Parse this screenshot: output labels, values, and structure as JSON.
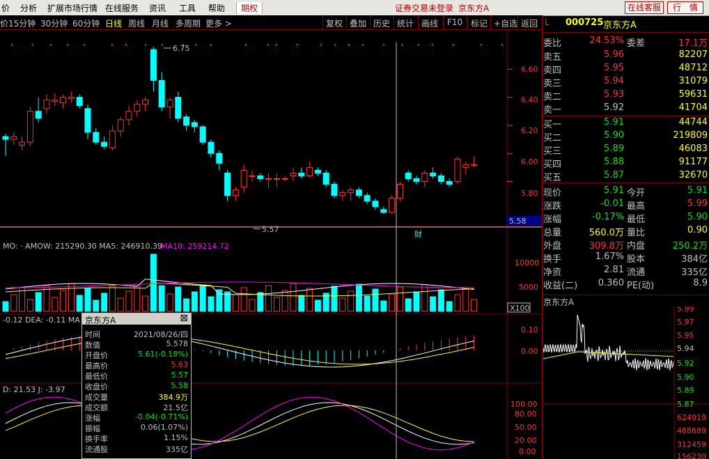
{
  "menubar": {
    "items": [
      "价",
      "分析",
      "扩展市场行情",
      "在线服务",
      "资讯",
      "工具",
      "帮助"
    ],
    "period_tab": "期权",
    "status": "证券交易未登录",
    "stock_name": "京东方A",
    "online_service": "在线客服",
    "quote": "行　情"
  },
  "toolbar": {
    "periods": [
      "价",
      "15分钟",
      "30分钟",
      "60分钟",
      "日线",
      "周线",
      "月线",
      "多周期",
      "更多 >"
    ],
    "selected_period": "日线",
    "tools": [
      "复权",
      "叠加",
      "历史",
      "统计",
      "画线",
      "F10",
      "标记",
      "+自选",
      "返回"
    ]
  },
  "chart": {
    "price_axis": [
      "6.60",
      "6.40",
      "6.20",
      "6.00",
      "5.80"
    ],
    "current_price_tag": "5.58",
    "high_label": "6.75",
    "low_label": "5.57",
    "fin_marker": "财",
    "volume": {
      "legend": "MO: ·  AMOW: 215290.30  MA5: 246910.39",
      "legend_ma10": "MA10: 259214.72",
      "axis": [
        "10000",
        "5000"
      ],
      "unit": "X100"
    },
    "macd": {
      "legend": "-0.12  DEA: -0.11  MA",
      "axis": [
        "0.10",
        "0.00"
      ]
    },
    "kdj": {
      "legend": "D: 21.53  J: -3.97",
      "axis": [
        "100.00",
        "80.00",
        "50.00",
        "20.00",
        "0.00"
      ]
    }
  },
  "chart_data": {
    "type": "candlestick",
    "title": "京东方A 日线",
    "ylim": [
      5.5,
      6.8
    ],
    "candles_ohlc": [
      [
        6.12,
        6.14,
        5.98,
        6.1
      ],
      [
        6.1,
        6.15,
        6.06,
        6.12
      ],
      [
        6.06,
        6.12,
        6.02,
        6.08
      ],
      [
        6.08,
        6.33,
        6.05,
        6.3
      ],
      [
        6.3,
        6.4,
        6.22,
        6.25
      ],
      [
        6.32,
        6.42,
        6.28,
        6.38
      ],
      [
        6.37,
        6.43,
        6.34,
        6.38
      ],
      [
        6.36,
        6.42,
        6.32,
        6.4
      ],
      [
        6.39,
        6.44,
        6.36,
        6.4
      ],
      [
        6.4,
        6.42,
        6.32,
        6.34
      ],
      [
        6.32,
        6.35,
        6.1,
        6.15
      ],
      [
        6.15,
        6.18,
        6.06,
        6.08
      ],
      [
        6.08,
        6.12,
        6.03,
        6.05
      ],
      [
        6.04,
        6.2,
        6.02,
        6.16
      ],
      [
        6.16,
        6.26,
        6.12,
        6.24
      ],
      [
        6.24,
        6.34,
        6.2,
        6.3
      ],
      [
        6.3,
        6.38,
        6.26,
        6.35
      ],
      [
        6.35,
        6.4,
        6.3,
        6.38
      ],
      [
        6.74,
        6.76,
        6.44,
        6.52
      ],
      [
        6.52,
        6.58,
        6.3,
        6.33
      ],
      [
        6.33,
        6.4,
        6.25,
        6.38
      ],
      [
        6.4,
        6.44,
        6.22,
        6.25
      ],
      [
        6.26,
        6.28,
        6.16,
        6.2
      ],
      [
        6.22,
        6.24,
        6.15,
        6.19
      ],
      [
        6.19,
        6.2,
        6.06,
        6.08
      ],
      [
        6.08,
        6.1,
        5.97,
        6.0
      ],
      [
        6.0,
        6.02,
        5.88,
        5.93
      ],
      [
        5.86,
        5.88,
        5.66,
        5.7
      ],
      [
        5.7,
        5.76,
        5.66,
        5.74
      ],
      [
        5.76,
        5.92,
        5.72,
        5.88
      ],
      [
        5.84,
        5.88,
        5.8,
        5.84
      ],
      [
        5.84,
        5.86,
        5.8,
        5.82
      ],
      [
        5.82,
        5.86,
        5.75,
        5.82
      ],
      [
        5.82,
        5.86,
        5.76,
        5.82
      ],
      [
        5.82,
        5.84,
        5.8,
        5.82
      ],
      [
        5.84,
        5.9,
        5.8,
        5.86
      ],
      [
        5.86,
        5.9,
        5.82,
        5.84
      ],
      [
        5.84,
        5.94,
        5.83,
        5.9
      ],
      [
        5.88,
        5.9,
        5.84,
        5.86
      ],
      [
        5.86,
        5.88,
        5.76,
        5.78
      ],
      [
        5.78,
        5.8,
        5.68,
        5.7
      ],
      [
        5.7,
        5.74,
        5.66,
        5.72
      ],
      [
        5.72,
        5.76,
        5.66,
        5.74
      ],
      [
        5.74,
        5.76,
        5.68,
        5.7
      ],
      [
        5.7,
        5.72,
        5.64,
        5.66
      ],
      [
        5.66,
        5.68,
        5.6,
        5.62
      ],
      [
        5.6,
        5.62,
        5.57,
        5.58
      ],
      [
        5.58,
        5.7,
        5.57,
        5.68
      ],
      [
        5.68,
        5.8,
        5.66,
        5.78
      ],
      [
        5.86,
        5.88,
        5.8,
        5.82
      ],
      [
        5.82,
        5.84,
        5.78,
        5.8
      ],
      [
        5.8,
        5.88,
        5.76,
        5.86
      ],
      [
        5.86,
        5.9,
        5.82,
        5.84
      ],
      [
        5.84,
        5.86,
        5.78,
        5.8
      ],
      [
        5.8,
        5.82,
        5.76,
        5.78
      ],
      [
        5.8,
        5.98,
        5.78,
        5.96
      ],
      [
        5.9,
        5.94,
        5.85,
        5.92
      ],
      [
        5.92,
        5.98,
        5.9,
        5.92
      ]
    ]
  },
  "right_panel": {
    "code_label": "L",
    "code": "000725",
    "name": "京东方A",
    "weibi": {
      "label": "委比",
      "value": "24.53%",
      "wc_label": "委差",
      "wc_value": "17.1万"
    },
    "asks": [
      {
        "label": "卖五",
        "price": "5.96",
        "vol": "82207"
      },
      {
        "label": "卖四",
        "price": "5.95",
        "vol": "48712"
      },
      {
        "label": "卖三",
        "price": "5.94",
        "vol": "31079"
      },
      {
        "label": "卖二",
        "price": "5.93",
        "vol": "59631"
      },
      {
        "label": "卖一",
        "price": "5.92",
        "vol": "41704"
      }
    ],
    "bids": [
      {
        "label": "买一",
        "price": "5.91",
        "vol": "44744"
      },
      {
        "label": "买二",
        "price": "5.90",
        "vol": "219809"
      },
      {
        "label": "买三",
        "price": "5.89",
        "vol": "46083"
      },
      {
        "label": "买四",
        "price": "5.88",
        "vol": "91177"
      },
      {
        "label": "买五",
        "price": "5.87",
        "vol": "32670"
      }
    ],
    "stats": [
      {
        "k1": "现价",
        "v1": "5.91",
        "c1": "gr",
        "k2": "今开",
        "v2": "5.91",
        "c2": "gr"
      },
      {
        "k1": "涨跌",
        "v1": "-0.01",
        "c1": "gr",
        "k2": "最高",
        "v2": "5.99",
        "c2": "rd"
      },
      {
        "k1": "涨幅",
        "v1": "-0.17%",
        "c1": "gr",
        "k2": "最低",
        "v2": "5.90",
        "c2": "gr"
      },
      {
        "k1": "总量",
        "v1": "560.0万",
        "c1": "yl",
        "k2": "量比",
        "v2": "0.90",
        "c2": "yl"
      },
      {
        "k1": "外盘",
        "v1": "309.8万",
        "c1": "rd",
        "k2": "内盘",
        "v2": "250.2万",
        "c2": "gr"
      },
      {
        "k1": "换手",
        "v1": "1.67%",
        "c1": "wt",
        "k2": "股本",
        "v2": "384亿",
        "c2": "wt"
      },
      {
        "k1": "净资",
        "v1": "2.81",
        "c1": "wt",
        "k2": "流通",
        "v2": "335亿",
        "c2": "wt"
      },
      {
        "k1": "收益(二)",
        "v1": "0.360",
        "c1": "wt",
        "k2": "PE(动)",
        "v2": "8.9",
        "c2": "wt"
      }
    ],
    "mini": {
      "title": "京东方A",
      "price_axis": [
        "5.99",
        "5.97",
        "5.95",
        "5.94",
        "5.92",
        "5.90",
        "5.89",
        "5.87"
      ],
      "vol_axis": [
        "624919",
        "468689",
        "312459",
        "156230"
      ]
    }
  },
  "popup": {
    "title": "京东方A",
    "rows": [
      {
        "k": "时间",
        "v": "2021/08/26/四",
        "c": "wt"
      },
      {
        "k": "数值",
        "v": "5.578",
        "c": "wt"
      },
      {
        "k": "开盘价",
        "v": "5.61(-0.18%)",
        "c": "gr"
      },
      {
        "k": "最高价",
        "v": "5.63",
        "c": "rd"
      },
      {
        "k": "最低价",
        "v": "5.57",
        "c": "gr"
      },
      {
        "k": "收盘价",
        "v": "5.58",
        "c": "gr"
      },
      {
        "k": "成交量",
        "v": "384.9万",
        "c": "yl"
      },
      {
        "k": "成交额",
        "v": "21.5亿",
        "c": "wt"
      },
      {
        "k": "涨幅",
        "v": "-0.04(-0.71%)",
        "c": "gr"
      },
      {
        "k": "振幅",
        "v": "0.06(1.07%)",
        "c": "wt"
      },
      {
        "k": "换手率",
        "v": "1.15%",
        "c": "wt"
      },
      {
        "k": "流通股",
        "v": "335亿",
        "c": "wt"
      }
    ]
  }
}
